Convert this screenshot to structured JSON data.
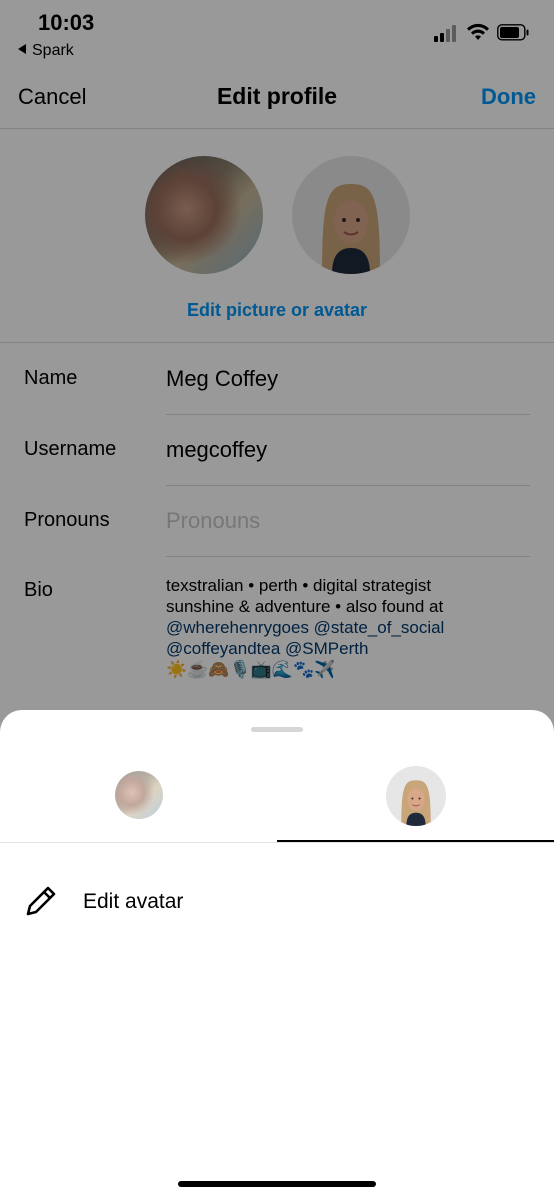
{
  "status_bar": {
    "time": "10:03",
    "back_app": "Spark"
  },
  "nav": {
    "cancel": "Cancel",
    "title": "Edit profile",
    "done": "Done"
  },
  "profile": {
    "edit_picture_label": "Edit picture or avatar"
  },
  "fields": {
    "name": {
      "label": "Name",
      "value": "Meg Coffey"
    },
    "username": {
      "label": "Username",
      "value": "megcoffey"
    },
    "pronouns": {
      "label": "Pronouns",
      "placeholder": "Pronouns"
    },
    "bio": {
      "label": "Bio",
      "line1": "texstralian • perth • digital strategist",
      "line2": "sunshine & adventure • also found at",
      "line3": "@wherehenrygoes @state_of_social",
      "line4": "@coffeyandtea @SMPerth",
      "line5": "☀️☕️🙈🎙️📺🌊🐾✈️"
    }
  },
  "sheet": {
    "tabs": [
      {
        "name": "photo"
      },
      {
        "name": "avatar"
      }
    ],
    "active_tab": 1,
    "edit_avatar_label": "Edit avatar"
  },
  "colors": {
    "accent": "#0095f6",
    "link": "#00376b",
    "placeholder": "#c7c7c7"
  }
}
